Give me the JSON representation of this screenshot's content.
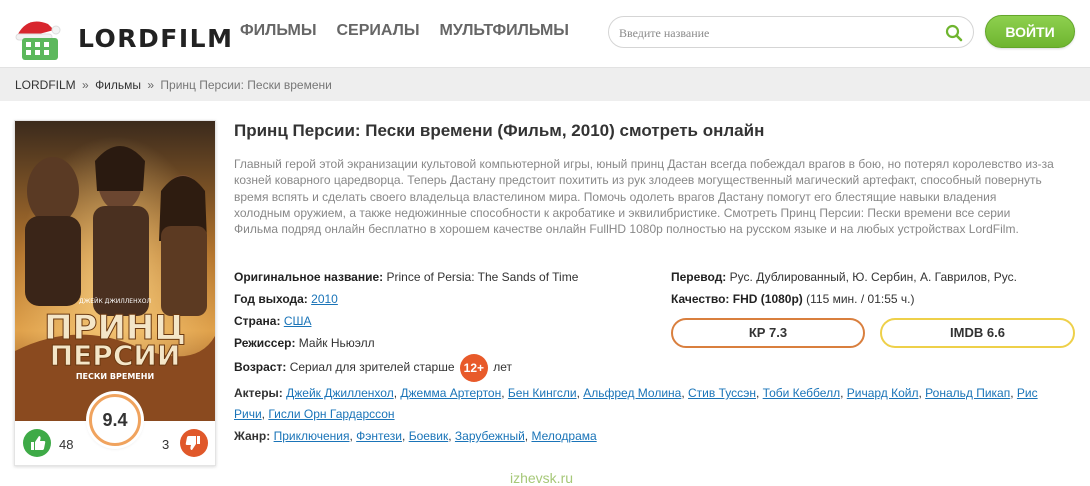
{
  "header": {
    "logo_text": "LORDFILM",
    "nav": [
      "ФИЛЬМЫ",
      "СЕРИАЛЫ",
      "МУЛЬТФИЛЬМЫ"
    ],
    "search_placeholder": "Введите название",
    "login_label": "ВОЙТИ"
  },
  "breadcrumb": {
    "home": "LORDFILM",
    "sep": "»",
    "section": "Фильмы",
    "current": "Принц Персии: Пески времени"
  },
  "poster": {
    "actor_credit": "ДЖЕЙК ДЖИЛЛЕНХОЛ",
    "title_line1": "ПРИНЦ",
    "title_line2": "ПЕРСИИ",
    "subtitle": "ПЕСКИ ВРЕМЕНИ",
    "rating": "9.4",
    "likes": "48",
    "dislikes": "3"
  },
  "movie": {
    "title": "Принц Персии: Пески времени (Фильм, 2010) смотреть онлайн",
    "description": "Главный герой этой экранизации культовой компьютерной игры, юный принц Дастан всегда побеждал врагов в бою, но потерял королевство из-за козней коварного царедворца. Теперь Дастану предстоит похитить из рук злодеев могущественный магический артефакт, способный повернуть время вспять и сделать своего владельца властелином мира. Помочь одолеть врагов Дастану помогут его блестящие навыки владения холодным оружием, а также недюжинные способности к акробатике и эквилибристике. Смотреть Принц Персии: Пески времени все серии Фильма подряд онлайн бесплатно в хорошем качестве онлайн FullHD 1080p полностью на русском языке и на любых устройствах LordFilm.",
    "original_label": "Оригинальное название:",
    "original_value": "Prince of Persia: The Sands of Time",
    "year_label": "Год выхода:",
    "year_value": "2010",
    "country_label": "Страна:",
    "country_value": "США",
    "director_label": "Режиссер:",
    "director_value": "Майк Ньюэлл",
    "age_label": "Возраст:",
    "age_text_before": "Сериал для зрителей старше",
    "age_badge": "12+",
    "age_text_after": "лет",
    "translation_label": "Перевод:",
    "translation_value": "Рус. Дублированный, Ю. Сербин, А. Гаврилов, Рус.",
    "quality_label": "Качество:",
    "quality_value": "FHD (1080p)",
    "duration_value": "(115 мин. / 01:55 ч.)",
    "kp_label": "КР 7.3",
    "imdb_label": "IMDB 6.6",
    "actors_label": "Актеры:",
    "actors": [
      "Джейк Джилленхол",
      "Джемма Артертон",
      "Бен Кингсли",
      "Альфред Молина",
      "Стив Туссэн",
      "Тоби Кеббелл",
      "Ричард Койл",
      "Рональд Пикап",
      "Рис Ричи",
      "Гисли Орн Гардарссон"
    ],
    "genre_label": "Жанр:",
    "genres": [
      "Приключения",
      "Фэнтези",
      "Боевик",
      "Зарубежный",
      "Мелодрама"
    ]
  },
  "watermark": "izhevsk.ru"
}
